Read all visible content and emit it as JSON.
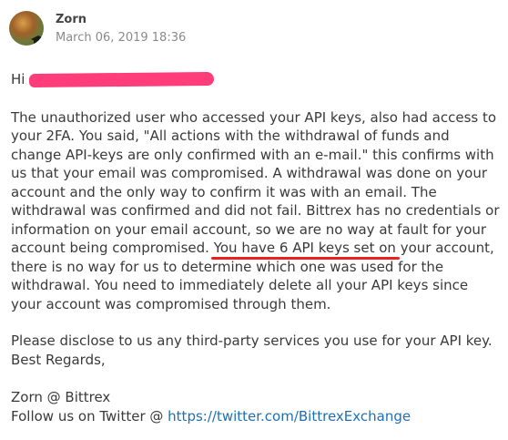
{
  "header": {
    "author": "Zorn",
    "timestamp": "March 06, 2019 18:36"
  },
  "message": {
    "greeting": "Hi",
    "para1_part1": "The unauthorized user who accessed your API keys, also had access to your 2FA. You said, \"All actions with the withdrawal of funds and change API-keys are only confirmed with an e-mail.\" this confirms with us that your email was compromised. A withdrawal was done on your account and the only way to confirm it was with an email. The withdrawal was confirmed and did not fail. Bittrex has no credentials or information on your email account, so we are no way at fault for your account being compromised. ",
    "para1_highlight": "You have 6 API keys set on",
    "para1_part2": " your account, there is no way for us to determine which one was used for the withdrawal. You need to immediately delete all your API keys since your account was compromised through them.",
    "para2": "Please disclose to us any third-party services you use for your API key.",
    "closing": "Best Regards,",
    "signature": "Zorn @ Bittrex",
    "follow_prefix": "Follow us on Twitter @ ",
    "twitter_link": "https://twitter.com/BittrexExchange"
  },
  "colors": {
    "redaction": "#ff3d7b",
    "underline": "#e8231f",
    "link": "#1e6fb6"
  }
}
